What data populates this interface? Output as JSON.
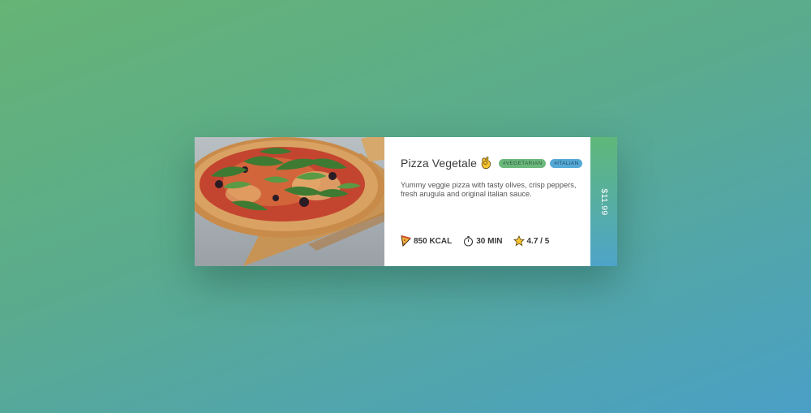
{
  "card": {
    "title": "Pizza Vegetale",
    "title_emoji": "ok-hand-icon",
    "tags": [
      {
        "label": "#VEGETARIAN",
        "color": "#6bb87c"
      },
      {
        "label": "#ITALIAN",
        "color": "#56a9d6"
      }
    ],
    "description": "Yummy veggie pizza with tasty olives, crisp peppers, fresh arugula and original italian sauce.",
    "stats": [
      {
        "icon": "pizza-slice-icon",
        "text": "850 KCAL"
      },
      {
        "icon": "timer-icon",
        "text": "30 MIN"
      },
      {
        "icon": "star-icon",
        "text": "4.7 / 5"
      }
    ],
    "price": "$11.99"
  },
  "colors": {
    "background_start": "#66b475",
    "background_end": "#4aa0c6",
    "accent_green": "#5fb879",
    "accent_blue": "#4ea4c9"
  }
}
